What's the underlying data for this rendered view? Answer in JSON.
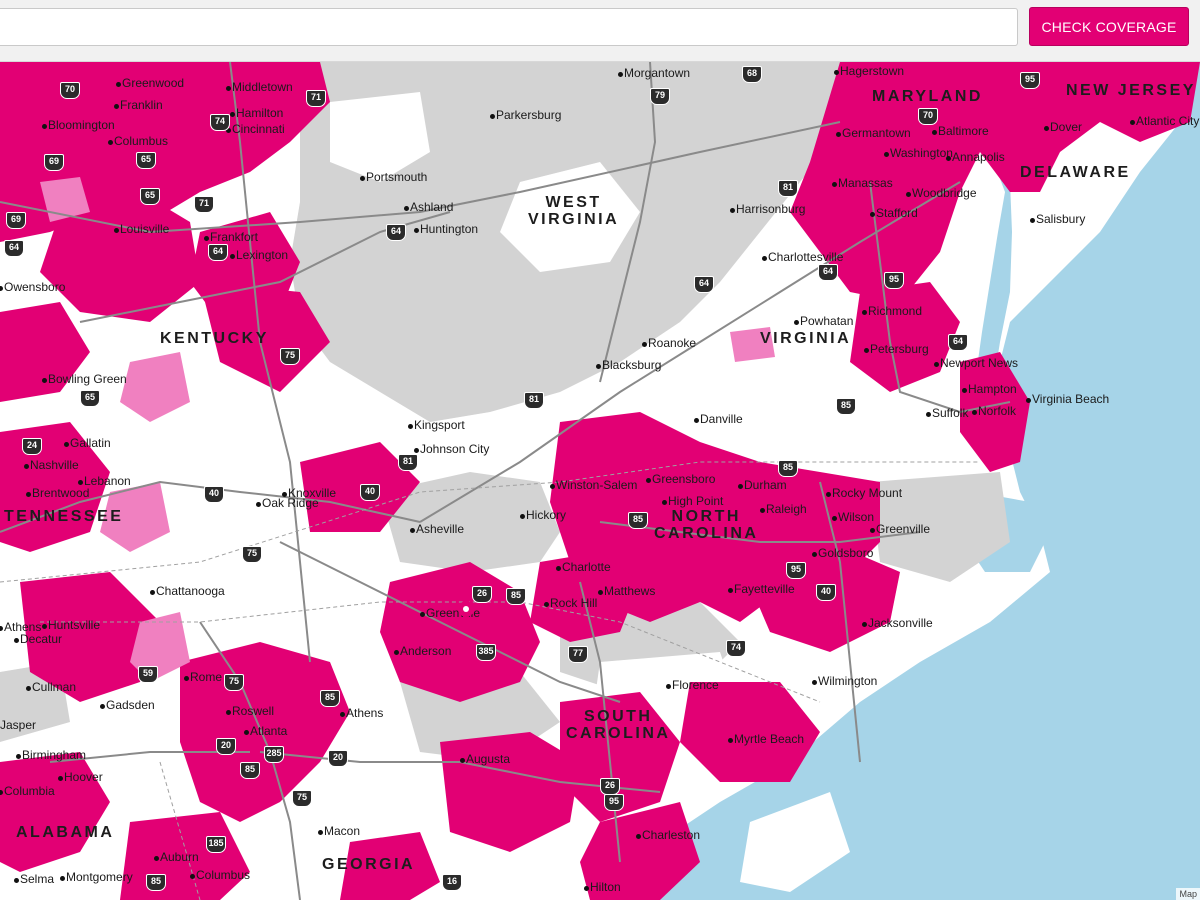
{
  "search": {
    "placeholder": "",
    "value": ""
  },
  "button": {
    "label": "CHECK COVERAGE"
  },
  "colors": {
    "coverage": "#e20074",
    "partner": "#f080c0",
    "none": "#d2d2d2",
    "water": "#a6d4e8",
    "accent": "#e20074"
  },
  "map": {
    "attribution": "Map",
    "states": [
      {
        "name": "MARYLAND"
      },
      {
        "name": "NEW JERSEY"
      },
      {
        "name": "DELAWARE"
      },
      {
        "name": "WEST\nVIRGINIA"
      },
      {
        "name": "KENTUCKY"
      },
      {
        "name": "VIRGINIA"
      },
      {
        "name": "NORTH\nCAROLINA"
      },
      {
        "name": "TENNESSEE"
      },
      {
        "name": "SOUTH\nCAROLINA"
      },
      {
        "name": "ALABAMA"
      },
      {
        "name": "GEORGIA"
      }
    ],
    "cities": [
      "Hagerstown",
      "Morgantown",
      "Parkersburg",
      "Cincinnati",
      "Middletown",
      "Greenwood",
      "Hamilton",
      "Franklin",
      "Columbus",
      "Bloomington",
      "Baltimore",
      "Germantown",
      "Washington",
      "Annapolis",
      "Dover",
      "Atlantic City",
      "Manassas",
      "Woodbridge",
      "Stafford",
      "Salisbury",
      "Harrisonburg",
      "Charlottesville",
      "Portsmouth",
      "Ashland",
      "Huntington",
      "Louisville",
      "Frankfort",
      "Lexington",
      "Owensboro",
      "Richmond",
      "Powhatan",
      "Petersburg",
      "Newport News",
      "Hampton",
      "Virginia Beach",
      "Suffolk",
      "Norfolk",
      "Roanoke",
      "Blacksburg",
      "Danville",
      "Bowling Green",
      "Kingsport",
      "Johnson City",
      "Knoxville",
      "Oak Ridge",
      "Nashville",
      "Brentwood",
      "Lebanon",
      "Gallatin",
      "Winston-Salem",
      "Greensboro",
      "High Point",
      "Durham",
      "Raleigh",
      "Rocky Mount",
      "Wilson",
      "Greenville",
      "Goldsboro",
      "Fayetteville",
      "Jacksonville",
      "Wilmington",
      "Hickory",
      "Asheville",
      "Charlotte",
      "Rock Hill",
      "Matthews",
      "Greenville",
      "Anderson",
      "Chattanooga",
      "Huntsville",
      "Athens",
      "Decatur",
      "Cullman",
      "Rome",
      "Gadsden",
      "Roswell",
      "Atlanta",
      "Athens",
      "Augusta",
      "Florence",
      "Myrtle Beach",
      "Charleston",
      "Birmingham",
      "Hoover",
      "Macon",
      "Auburn",
      "Columbus",
      "Montgomery",
      "Selma",
      "Hilton",
      "Columbia",
      "Jasper"
    ]
  }
}
